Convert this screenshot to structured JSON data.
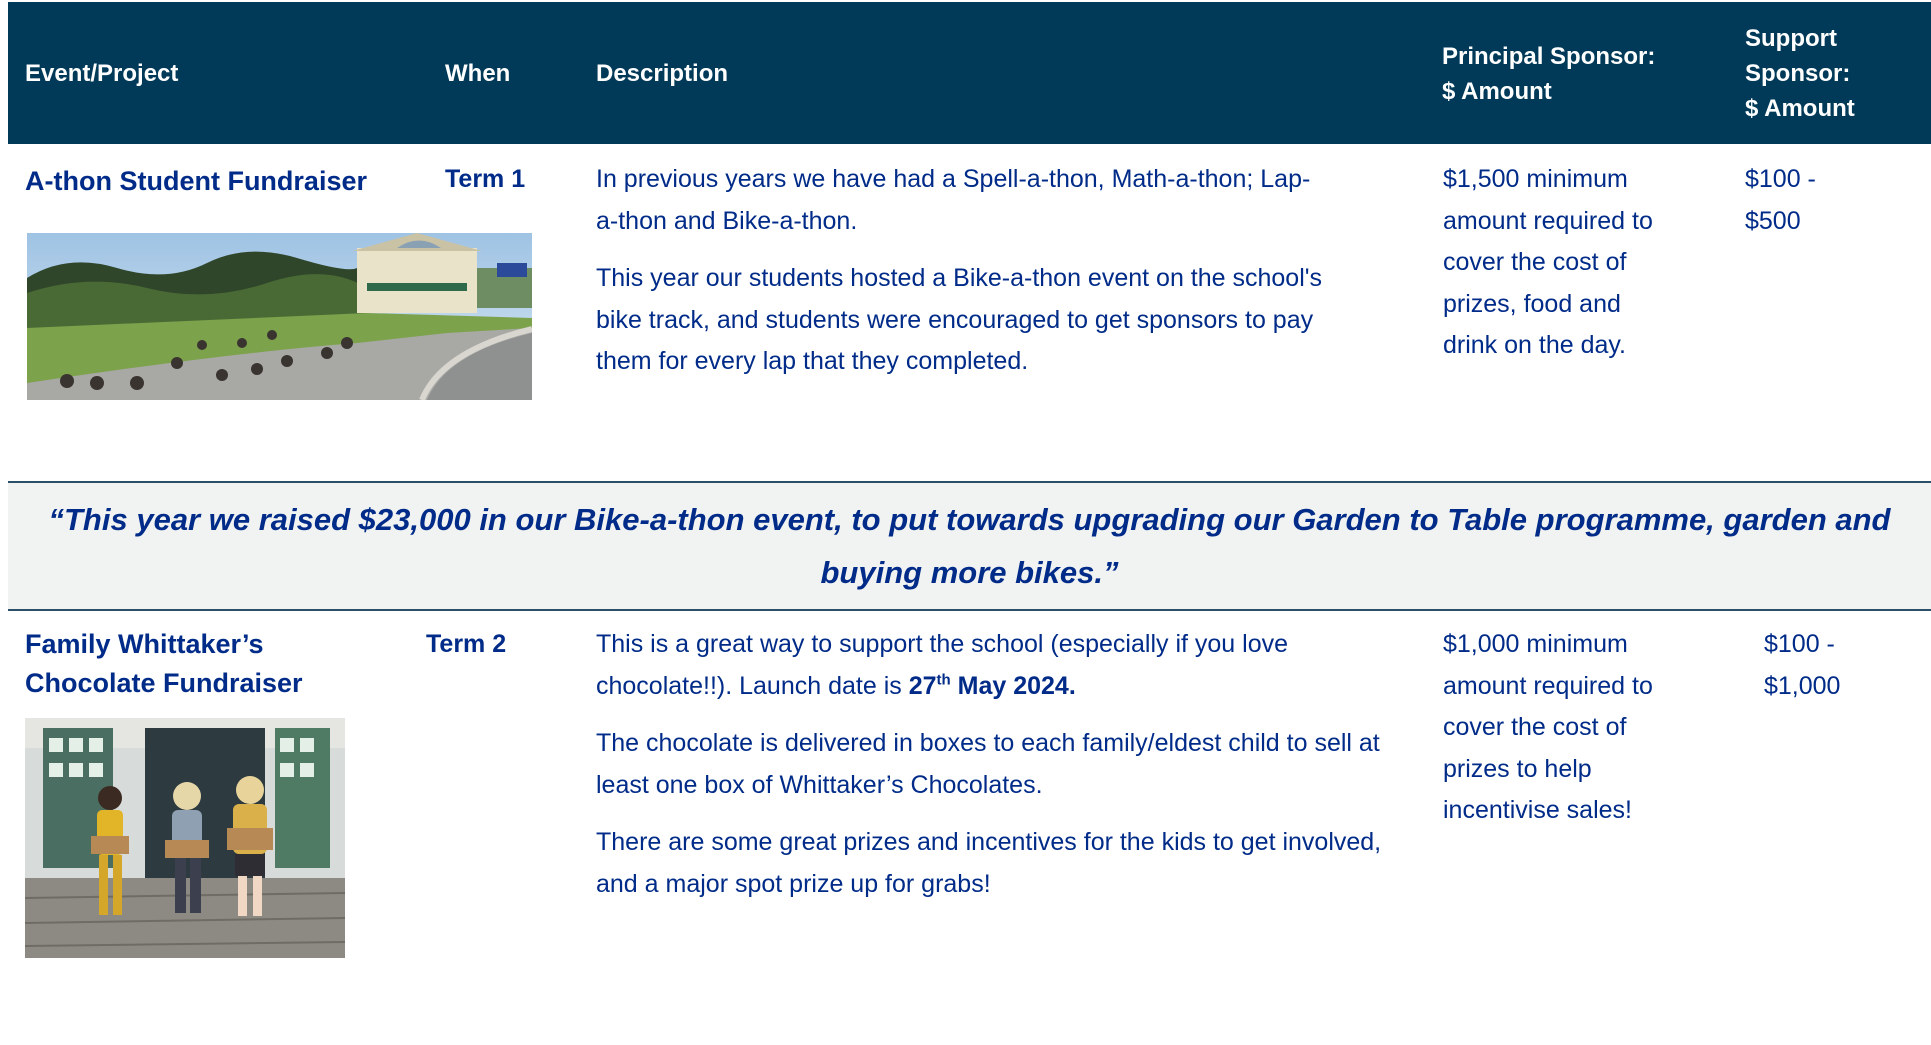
{
  "header": {
    "event_project": "Event/Project",
    "when": "When",
    "description": "Description",
    "principal_line1": "Principal Sponsor:",
    "principal_line2": "$ Amount",
    "support_line1": "Support",
    "support_line2": "Sponsor:",
    "support_line3": "$ Amount"
  },
  "rows": [
    {
      "title": "A-thon Student Fundraiser",
      "when": "Term 1",
      "description": [
        "In previous years we have had a Spell-a-thon, Math-a-thon; Lap-a-thon and Bike-a-thon.",
        "This year our students hosted a Bike-a-thon event on the school's bike track, and students were encouraged to get sponsors to pay them for every lap that they completed."
      ],
      "principal": "$1,500 minimum amount required to cover the cost of prizes, food and drink on the day.",
      "support": "$100 - $500"
    },
    {
      "title_line1": "Family Whittaker’s",
      "title_line2": "Chocolate Fundraiser",
      "when": "Term 2",
      "description_p1_start": "This is a great way to support the school (especially if you love chocolate!!). Launch date is ",
      "launch_day": "27",
      "launch_suffix": "th",
      "launch_rest": " May 2024.",
      "description": [
        "The chocolate is delivered in boxes to each family/eldest child to sell at least one box of Whittaker’s Chocolates.",
        "There are some great prizes and incentives for the kids to get involved, and a major spot prize up for grabs!"
      ],
      "principal": "$1,000 minimum amount required to cover the cost of prizes to help incentivise sales!",
      "support": "$100 - $1,000"
    }
  ],
  "quote": "“This year we raised $23,000 in our Bike-a-thon event, to put towards upgrading our Garden to Table programme, garden and buying more bikes.”"
}
